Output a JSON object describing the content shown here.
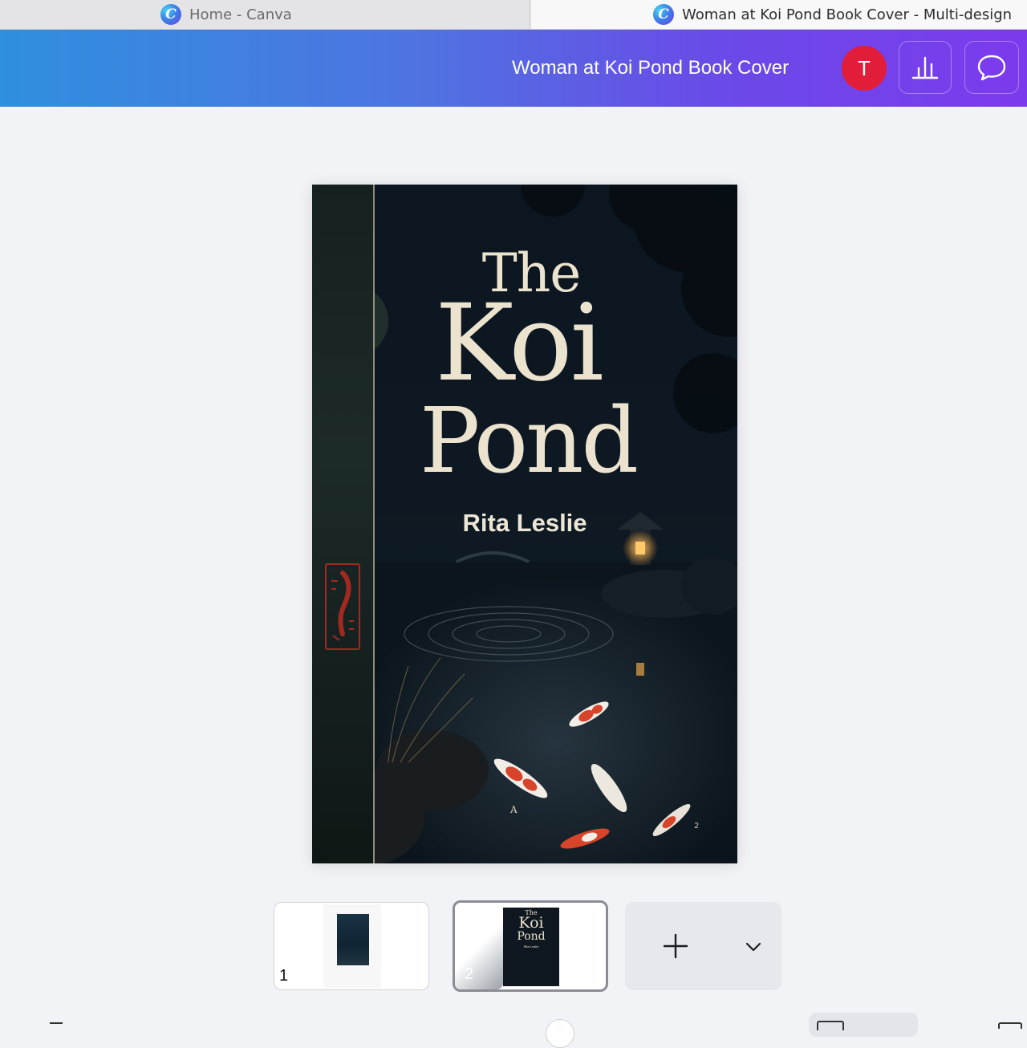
{
  "browser": {
    "tabs": [
      {
        "title": "Home - Canva",
        "active": false
      },
      {
        "title": "Woman at Koi Pond Book Cover - Multi-design",
        "active": true
      }
    ],
    "favicon_letter": "C"
  },
  "topbar": {
    "design_title": "Woman at Koi Pond Book Cover",
    "avatar_initial": "T",
    "icons": [
      "insights-chart-icon",
      "comment-icon"
    ],
    "colors": {
      "gradient_start": "#2f8fe0",
      "gradient_end": "#7c3aed",
      "avatar": "#e11d3a"
    }
  },
  "canvas": {
    "cover": {
      "title_line1": "The",
      "title_line2": "Koi",
      "title_line3": "Pond",
      "author": "Rita Leslie",
      "spine_letter": "A",
      "page_marker": "2"
    }
  },
  "pages": {
    "thumbnails": [
      {
        "number": "1",
        "selected": false
      },
      {
        "number": "2",
        "selected": true,
        "mini_title": [
          "The",
          "Koi",
          "Pond"
        ],
        "mini_author": "Rita Leslie"
      }
    ],
    "add_page_icon": "plus-icon",
    "more_icon": "chevron-down-icon"
  }
}
